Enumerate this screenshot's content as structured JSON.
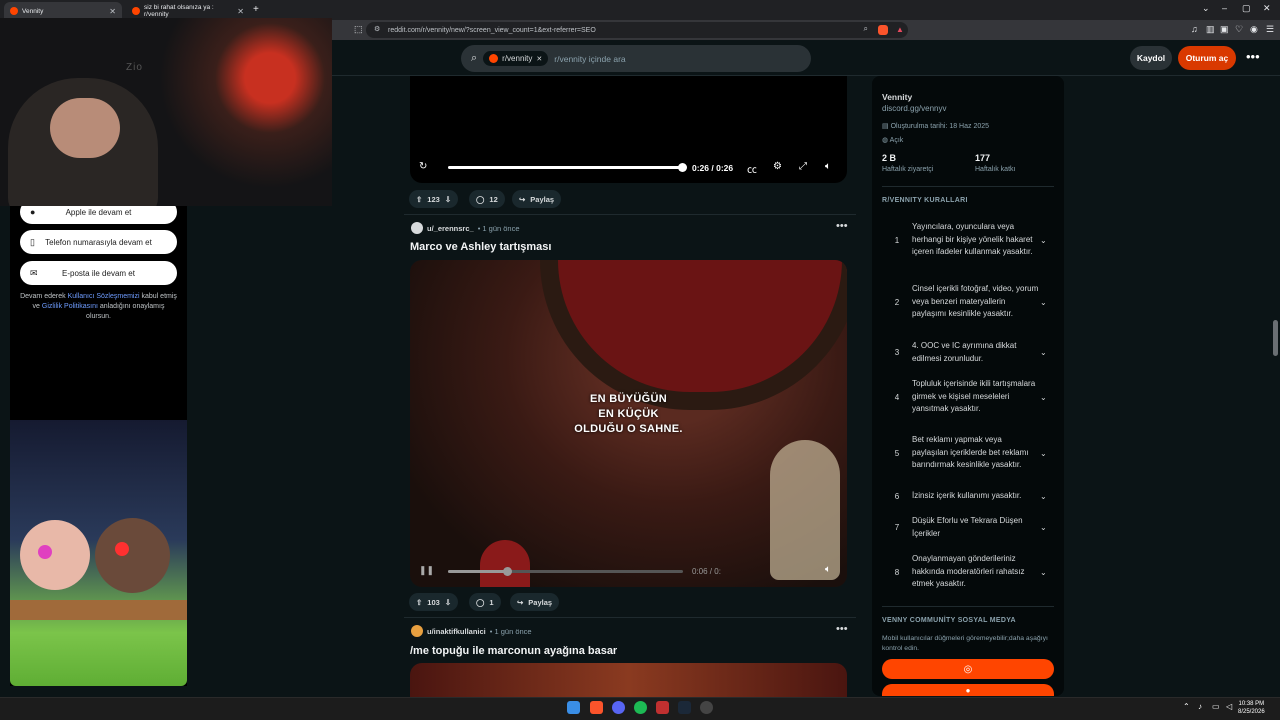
{
  "browser": {
    "tabs": [
      {
        "label": "Vennity",
        "active": true
      },
      {
        "label": "siz bi rahat olsanıza ya : r/vennity",
        "active": false
      }
    ],
    "new_tab": "+",
    "url": "reddit.com/r/vennity/new/?screen_view_count=1&ext-referrer=SEO",
    "window_controls": {
      "minimize": "–",
      "maximize": "▢",
      "close": "✕",
      "dropdown": "⌄"
    }
  },
  "header": {
    "search_chip": "r/vennity",
    "search_chip_close": "✕",
    "search_placeholder": "r/vennity içinde ara",
    "signup": "Kaydol",
    "login": "Oturum aç",
    "more": "•••"
  },
  "webcam": {
    "logo": "Zio"
  },
  "login_panel": {
    "apple": "Apple ile devam et",
    "phone": "Telefon numarasıyla devam et",
    "email": "E-posta ile devam et",
    "legal_1": "Devam ederek",
    "legal_link_1": "Kullanıcı Sözleşmemizi",
    "legal_2": "kabul etmiş ve",
    "legal_link_2": "Gizlilik Politikasını",
    "legal_3": "anladığını onaylamış olursun."
  },
  "feed": {
    "video1": {
      "time": "0:26 / 0:26",
      "progress": 1.0
    },
    "post1_actions": {
      "votes": "123",
      "comments": "12",
      "share": "Paylaş"
    },
    "post2": {
      "user": "u/_erennsrc_",
      "time": "• 1 gün önce",
      "title": "Marco ve Ashley tartışması",
      "caption_1": "EN BÜYÜĞÜN",
      "caption_2": "EN KÜÇÜK",
      "caption_3": "OLDUĞU O SAHNE.",
      "video_time": "0:06 / 0:",
      "progress": 0.25,
      "votes": "103",
      "comments": "1",
      "share": "Paylaş"
    },
    "post3": {
      "user": "u/inaktifkullanici",
      "time": "• 1 gün önce",
      "title": "/me topuğu ile marconun ayağına basar"
    },
    "menu": "•••"
  },
  "sidebar": {
    "name": "Vennity",
    "discord": "discord.gg/vennyv",
    "created": "Oluşturulma tarihi: 18 Haz 2025",
    "visibility": "Açık",
    "visitors": "2 B",
    "visitors_label": "Haftalık ziyaretçi",
    "contributions": "177",
    "contributions_label": "Haftalık katkı",
    "rules_title": "R/VENNITY KURALLARI",
    "rules": [
      {
        "num": "1",
        "text": "Yayıncılara, oyunculara veya herhangi bir kişiye yönelik hakaret içeren ifadeler kullanmak yasaktır."
      },
      {
        "num": "2",
        "text": "Cinsel içerikli fotoğraf, video, yorum veya benzeri materyallerin paylaşımı kesinlikle yasaktır."
      },
      {
        "num": "3",
        "text": "4. OOC ve IC ayrımına dikkat edilmesi zorunludur."
      },
      {
        "num": "4",
        "text": "Topluluk içerisinde ikili tartışmalara girmek ve kişisel meseleleri yansıtmak yasaktır."
      },
      {
        "num": "5",
        "text": "Bet reklamı yapmak veya paylaşılan içeriklerde bet reklamı barındırmak kesinlikle yasaktır."
      },
      {
        "num": "6",
        "text": "İzinsiz içerik kullanımı yasaktır."
      },
      {
        "num": "7",
        "text": "Düşük Eforlu ve Tekrara Düşen İçerikler"
      },
      {
        "num": "8",
        "text": "Onaylanmayan gönderileriniz hakkında moderatörleri rahatsız etmek yasaktır."
      }
    ],
    "social_title": "VENNY COMMUNİTY SOSYAL MEDYA",
    "social_desc": "Mobil kullanıcılar düğmeleri göremeyebilir;daha aşağıyı kontrol edin."
  },
  "taskbar": {
    "time": "10:38 PM",
    "date": "8/25/2026"
  },
  "colors": {
    "accent": "#ff4500",
    "login_button": "#d93900",
    "background": "#0b1416"
  }
}
